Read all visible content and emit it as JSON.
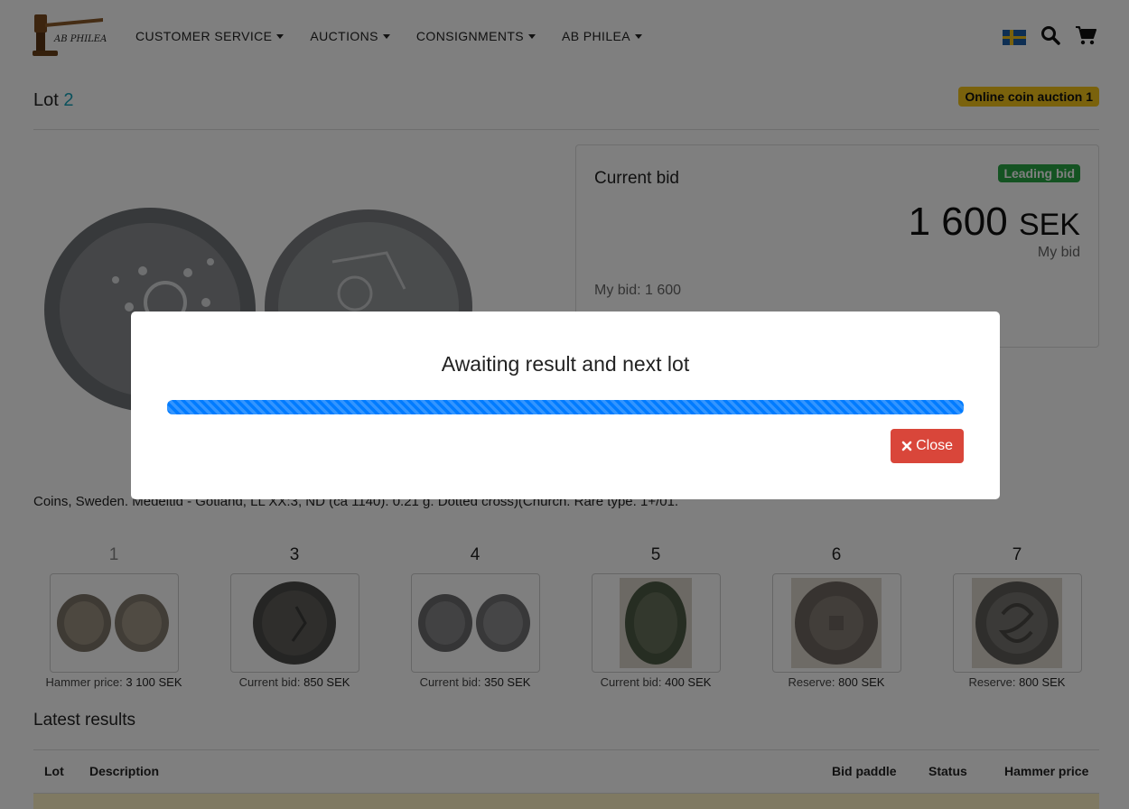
{
  "nav": {
    "brand": "AB PHILEA",
    "menu": [
      "CUSTOMER SERVICE",
      "AUCTIONS",
      "CONSIGNMENTS",
      "AB PHILEA"
    ],
    "icons": [
      "sweden-flag-icon",
      "search-icon",
      "cart-icon"
    ]
  },
  "lot": {
    "label": "Lot",
    "number": "2",
    "auction_badge": "Online coin auction 1",
    "description": "Coins, Sweden. Medeltid - Gotland, LL XX:3, ND (ca 1140). 0.21 g. Dotted cross)(Church. Rare type. 1+/01."
  },
  "bid": {
    "label": "Current bid",
    "status_badge": "Leading bid",
    "amount": "1 600",
    "currency": "SEK",
    "sub_label": "My bid",
    "my_bid": "My bid: 1 600"
  },
  "thumbs": [
    {
      "num": "1",
      "caption_label": "Hammer price:",
      "caption_value": "3 100 SEK"
    },
    {
      "num": "3",
      "caption_label": "Current bid:",
      "caption_value": "850 SEK"
    },
    {
      "num": "4",
      "caption_label": "Current bid:",
      "caption_value": "350 SEK"
    },
    {
      "num": "5",
      "caption_label": "Current bid:",
      "caption_value": "400 SEK"
    },
    {
      "num": "6",
      "caption_label": "Reserve:",
      "caption_value": "800 SEK"
    },
    {
      "num": "7",
      "caption_label": "Reserve:",
      "caption_value": "800 SEK"
    }
  ],
  "latest": {
    "title": "Latest results",
    "columns": [
      "Lot",
      "Description",
      "Bid paddle",
      "Status",
      "Hammer price"
    ]
  },
  "modal": {
    "title": "Awaiting result and next lot",
    "progress": 1.0,
    "close_label": "Close"
  },
  "colors": {
    "accent": "#17a2b8",
    "badge_yellow": "#f5c518",
    "leading_green": "#28a745",
    "progress_blue": "#007bff",
    "close_red": "#d9463a"
  }
}
